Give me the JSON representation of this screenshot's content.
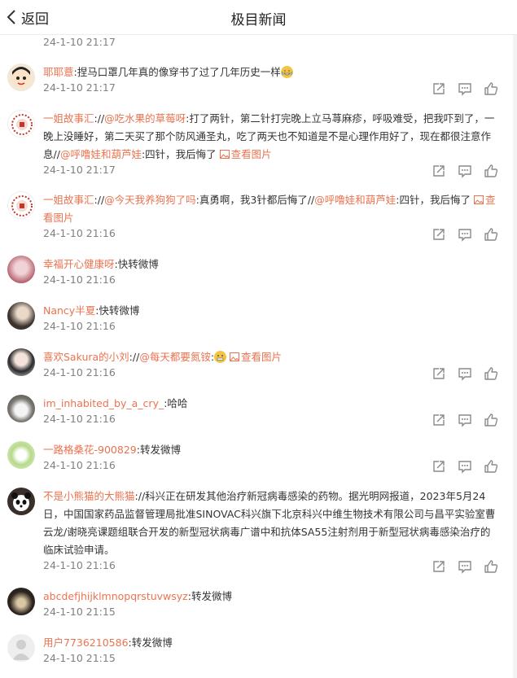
{
  "header": {
    "back_label": "返回",
    "title": "极目新闻"
  },
  "comments": [
    {
      "time": "24-1-10 21:17"
    },
    {
      "user": "耶耶薏",
      "text_a": ":捏马口罩几年真的像穿书了过了几年历史一样",
      "time": "24-1-10 21:17",
      "emoji": "crying-laughing"
    },
    {
      "user": "一姐故事汇",
      "line1_pre": "://",
      "mention1": "@吃水果的草莓呀",
      "line1_text": ":打了两针，第二针打完晚上立马荨麻疹，呼吸难受，把我吓到了，一晚上没睡好，第二天买了那个防风通圣丸，吃了两天也不知道是不是心理作用好了，现在都很注意作息//",
      "mention2": "@呼噜娃和葫芦娃",
      "tail": ":四针，我后悔了",
      "pic": "查看图片",
      "time": "24-1-10 21:17"
    },
    {
      "user": "一姐故事汇",
      "line1_pre": "://",
      "mention1": "@今天我养狗狗了吗",
      "mid": ":真勇啊，我3针都后悔了//",
      "mention2": "@呼噜娃和葫芦娃",
      "tail": ":四针，我后悔了",
      "pic": "查看图片",
      "time": "24-1-10 21:16"
    },
    {
      "user": "幸福开心健康呀",
      "text_a": ":快转微博",
      "time": "24-1-10 21:16"
    },
    {
      "user": "Nancy半夏",
      "text_a": ":快转微博",
      "time": "24-1-10 21:16"
    },
    {
      "user": "喜欢Sakura的小刘",
      "pre": "://",
      "mention1": "@每天都要氮铵",
      "pic": "查看图片",
      "time": "24-1-10 21:16"
    },
    {
      "user": "im_inhabited_by_a_cry_",
      "text_a": ":哈哈",
      "time": "24-1-10 21:16"
    },
    {
      "user": "一路格桑花-900829",
      "text_a": ":转发微博",
      "time": "24-1-10 21:16"
    },
    {
      "user": "不是小熊猫的大熊猫",
      "text_a": "://科兴正在研发其他治疗新冠病毒感染的药物。据光明网报道，2023年5月24日，中国国家药品监督管理局批准SINOVAC科兴旗下北京科兴中维生物技术有限公司与昌平实验室曹云龙/谢晓亮课题组联合开发的新型冠状病毒广谱中和抗体SA55注射剂用于新型冠状病毒感染治疗的临床试验申请。",
      "time": "24-1-10 21:16"
    },
    {
      "user": "abcdefjhijklmnopqrstuvwsyz",
      "text_a": ":转发微博",
      "time": "24-1-10 21:15"
    },
    {
      "user": "用户7736210586",
      "text_a": ":转发微博",
      "time": "24-1-10 21:15"
    }
  ],
  "colors": {
    "accent": "#eb7350",
    "time": "#808080",
    "icon": "#8a8a8a"
  }
}
